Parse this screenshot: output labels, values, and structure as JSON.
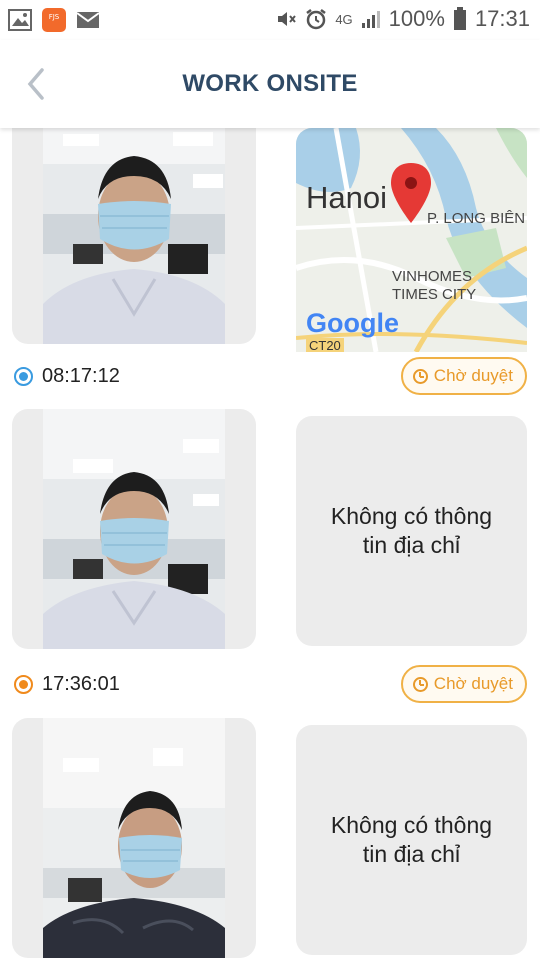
{
  "status_bar": {
    "icons_left": [
      "image-icon",
      "app-notification-icon",
      "mail-icon"
    ],
    "icons_right": [
      "mute-icon",
      "alarm-icon",
      "signal-icon"
    ],
    "network": "4G",
    "battery": "100%",
    "time": "17:31"
  },
  "header": {
    "title": "WORK ONSITE",
    "back_icon": "chevron-left-icon"
  },
  "colors": {
    "title": "#2f4a66",
    "status_pending": "#e89a2a",
    "radio_checkin": "#3a9be0",
    "radio_checkout": "#f08a1c",
    "card_bg": "#ececec"
  },
  "entries": [
    {
      "time": "08:17:12",
      "status": "Chờ duyệt",
      "radio_color": "#3a9be0",
      "has_map": true,
      "map": {
        "city": "Hanoi",
        "district": "P. LONG BIÊN",
        "area_line1": "VINHOMES",
        "area_line2": "TIMES CITY",
        "road": "CT20",
        "brand": "Google"
      }
    },
    {
      "time": "17:36:01",
      "status": "Chờ duyệt",
      "radio_color": "#f08a1c",
      "has_map": false,
      "no_address": "Không có thông tin địa chỉ"
    },
    {
      "no_address": "Không có thông tin địa chỉ"
    }
  ]
}
